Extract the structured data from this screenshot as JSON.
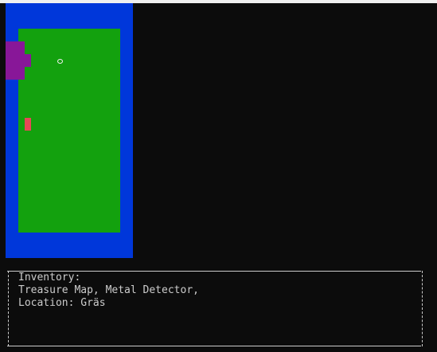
{
  "colors": {
    "background": "#0c0c0c",
    "water": "#0037da",
    "grass": "#13a10e",
    "structure": "#881798",
    "item": "#e74856",
    "player": "#f2f2f2",
    "text": "#cccccc"
  },
  "map": {
    "tiles": [
      "water",
      "grass",
      "structure",
      "item",
      "player-marker"
    ]
  },
  "status_panel": {
    "inventory_label": "Inventory:",
    "inventory_items": "Treasure Map, Metal Detector,",
    "location_line": "Location: Gräs"
  }
}
